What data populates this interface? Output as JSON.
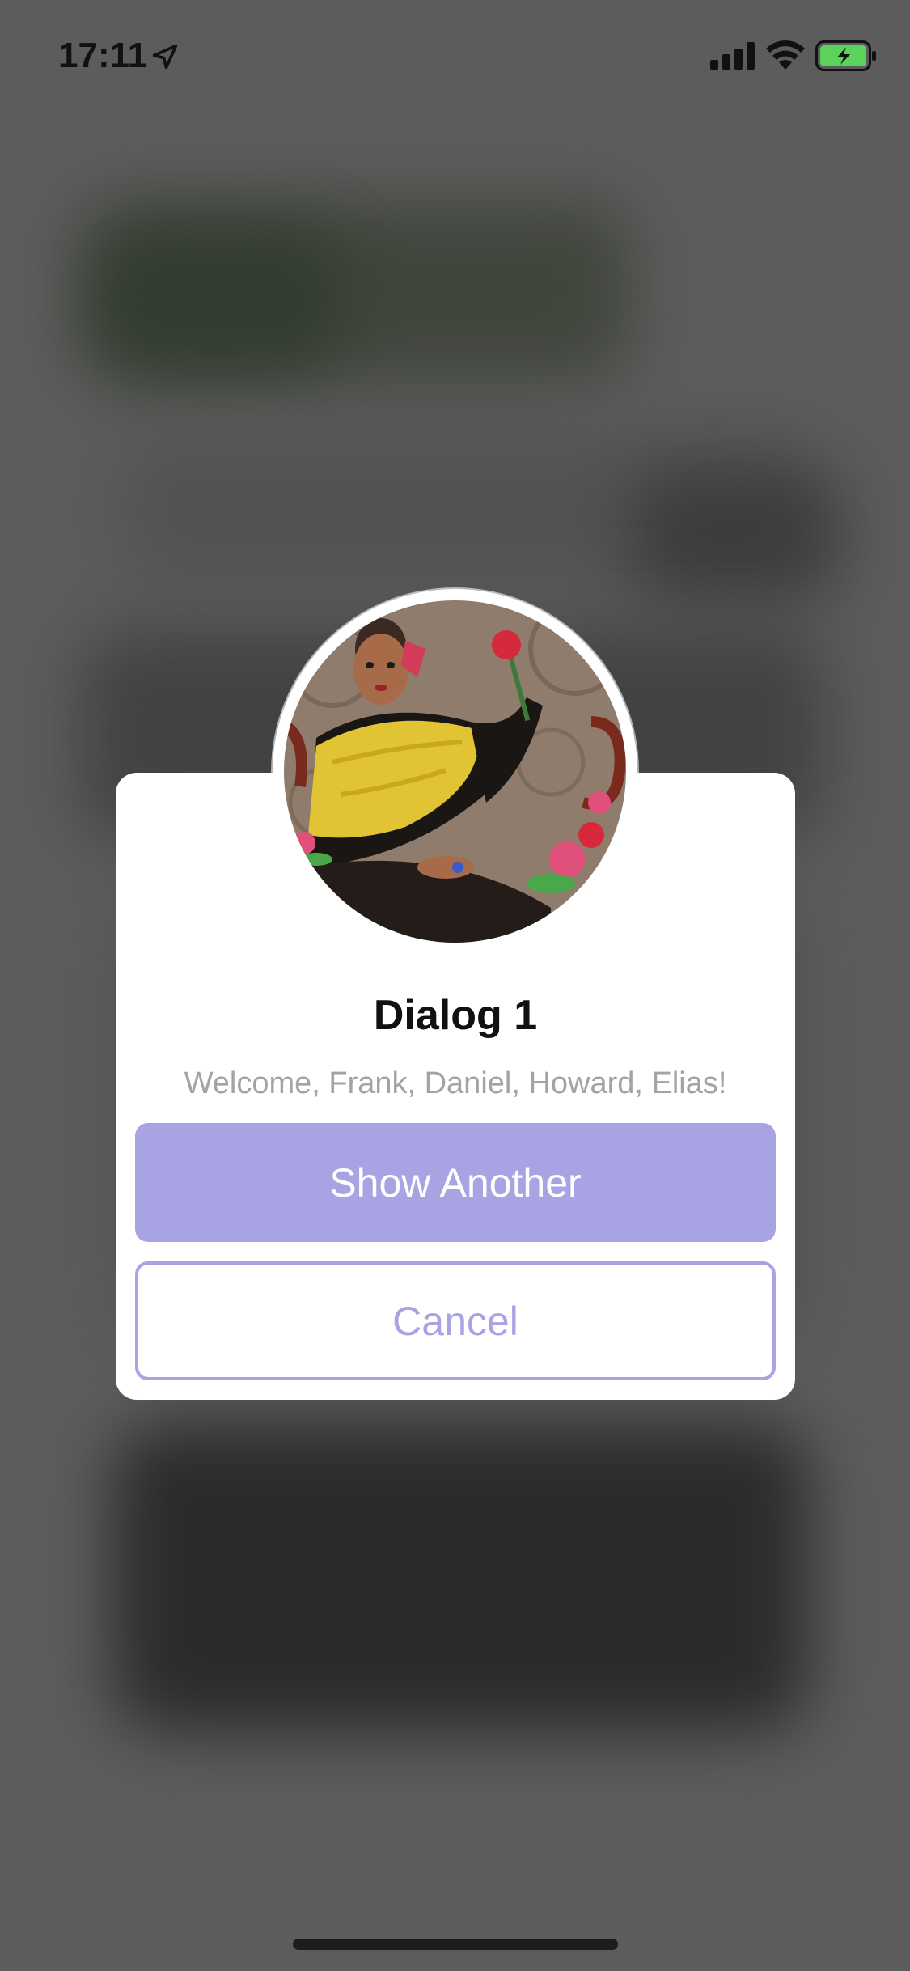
{
  "status_bar": {
    "time": "17:11",
    "icons": [
      "location-arrow-icon",
      "cellular-signal-icon",
      "wifi-icon",
      "battery-charging-icon"
    ],
    "battery_color": "#5bd35b"
  },
  "dialog": {
    "avatar": "illustrated-portrait-image",
    "title": "Dialog 1",
    "message": "Welcome, Frank, Daniel, Howard, Elias!",
    "primary_button_label": "Show Another",
    "secondary_button_label": "Cancel"
  },
  "colors": {
    "accent": "#a8a3e3",
    "overlay": "#5c5c5c",
    "dialog_background": "#ffffff",
    "message_text": "#a3a3a3"
  }
}
